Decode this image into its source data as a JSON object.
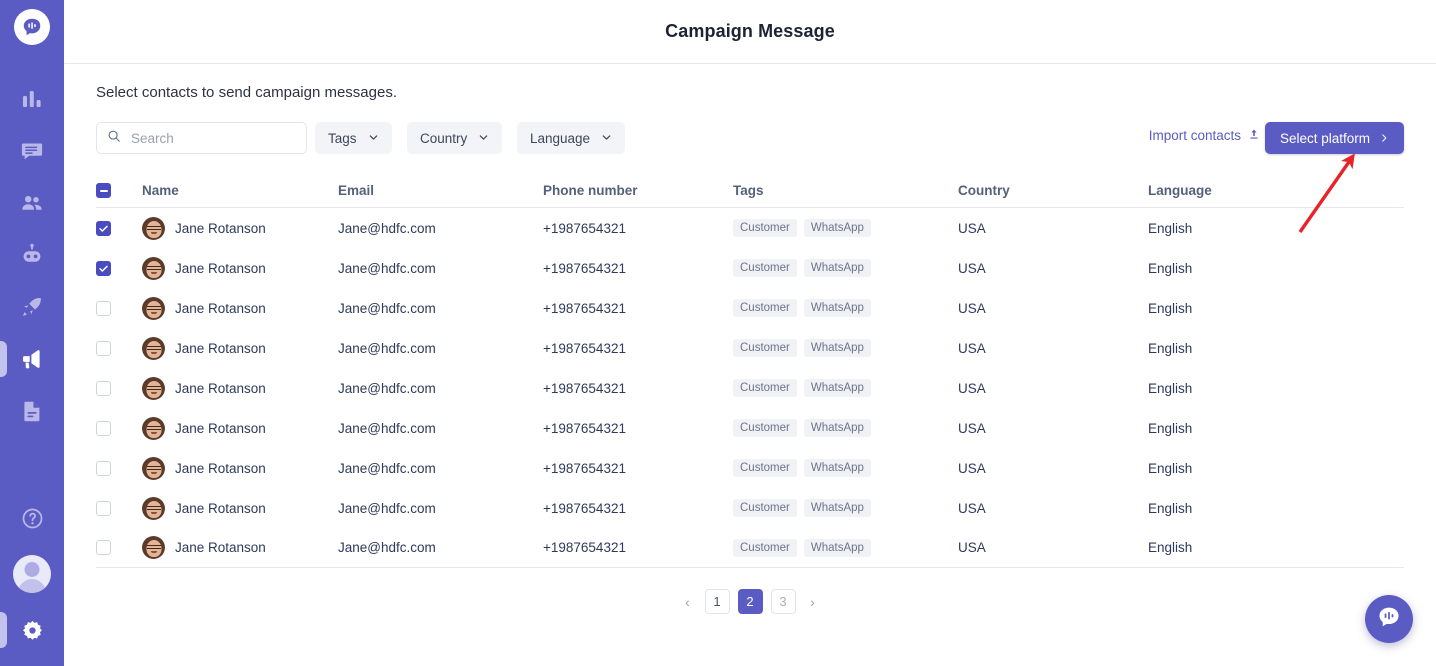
{
  "sidebar": {
    "logo_icon": "chat-bubble-logo-icon",
    "items": [
      {
        "icon": "analytics-bars-icon",
        "name": "analytics",
        "active": false
      },
      {
        "icon": "chat-message-icon",
        "name": "messages",
        "active": false
      },
      {
        "icon": "contacts-people-icon",
        "name": "contacts",
        "active": false
      },
      {
        "icon": "bot-icon",
        "name": "bot",
        "active": false
      },
      {
        "icon": "rocket-icon",
        "name": "automation",
        "active": false
      },
      {
        "icon": "megaphone-icon",
        "name": "campaign",
        "active": true
      },
      {
        "icon": "document-icon",
        "name": "templates",
        "active": false
      }
    ],
    "bottom_items": [
      {
        "icon": "help-question-icon",
        "name": "help",
        "active": false
      },
      {
        "icon": "user-avatar-icon",
        "name": "account",
        "active": false
      },
      {
        "icon": "gear-settings-icon",
        "name": "settings",
        "active": true
      }
    ],
    "accent_color": "#5b5bc4"
  },
  "header": {
    "title": "Campaign Message"
  },
  "main": {
    "subtitle": "Select contacts to send campaign messages."
  },
  "toolbar": {
    "search": {
      "value": "",
      "placeholder": "Search",
      "icon": "search-icon"
    },
    "filters": [
      {
        "label": "Tags",
        "icon": "chevron-down-icon"
      },
      {
        "label": "Country",
        "icon": "chevron-down-icon"
      },
      {
        "label": "Language",
        "icon": "chevron-down-icon"
      }
    ],
    "import_contacts": {
      "label": "Import contacts",
      "icon": "upload-icon"
    },
    "select_platform": {
      "label": "Select platform",
      "icon": "chevron-right-icon"
    }
  },
  "table": {
    "select_all_state": "indeterminate",
    "columns": [
      "Name",
      "Email",
      "Phone number",
      "Tags",
      "Country",
      "Language"
    ],
    "rows": [
      {
        "checked": true,
        "name": "Jane Rotanson",
        "email": "Jane@hdfc.com",
        "phone": "+1987654321",
        "tags": [
          "Customer",
          "WhatsApp"
        ],
        "country": "USA",
        "language": "English"
      },
      {
        "checked": true,
        "name": "Jane Rotanson",
        "email": "Jane@hdfc.com",
        "phone": "+1987654321",
        "tags": [
          "Customer",
          "WhatsApp"
        ],
        "country": "USA",
        "language": "English"
      },
      {
        "checked": false,
        "name": "Jane Rotanson",
        "email": "Jane@hdfc.com",
        "phone": "+1987654321",
        "tags": [
          "Customer",
          "WhatsApp"
        ],
        "country": "USA",
        "language": "English"
      },
      {
        "checked": false,
        "name": "Jane Rotanson",
        "email": "Jane@hdfc.com",
        "phone": "+1987654321",
        "tags": [
          "Customer",
          "WhatsApp"
        ],
        "country": "USA",
        "language": "English"
      },
      {
        "checked": false,
        "name": "Jane Rotanson",
        "email": "Jane@hdfc.com",
        "phone": "+1987654321",
        "tags": [
          "Customer",
          "WhatsApp"
        ],
        "country": "USA",
        "language": "English"
      },
      {
        "checked": false,
        "name": "Jane Rotanson",
        "email": "Jane@hdfc.com",
        "phone": "+1987654321",
        "tags": [
          "Customer",
          "WhatsApp"
        ],
        "country": "USA",
        "language": "English"
      },
      {
        "checked": false,
        "name": "Jane Rotanson",
        "email": "Jane@hdfc.com",
        "phone": "+1987654321",
        "tags": [
          "Customer",
          "WhatsApp"
        ],
        "country": "USA",
        "language": "English"
      },
      {
        "checked": false,
        "name": "Jane Rotanson",
        "email": "Jane@hdfc.com",
        "phone": "+1987654321",
        "tags": [
          "Customer",
          "WhatsApp"
        ],
        "country": "USA",
        "language": "English"
      },
      {
        "checked": false,
        "name": "Jane Rotanson",
        "email": "Jane@hdfc.com",
        "phone": "+1987654321",
        "tags": [
          "Customer",
          "WhatsApp"
        ],
        "country": "USA",
        "language": "English"
      }
    ]
  },
  "pagination": {
    "prev_icon": "chevron-left-icon",
    "next_icon": "chevron-right-icon",
    "pages": [
      "1",
      "2",
      "3"
    ],
    "current": "2"
  },
  "chat_fab": {
    "icon": "chat-bubble-icon"
  },
  "annotation": {
    "type": "arrow",
    "color": "#e8232a",
    "points_at": "select-platform-button"
  }
}
